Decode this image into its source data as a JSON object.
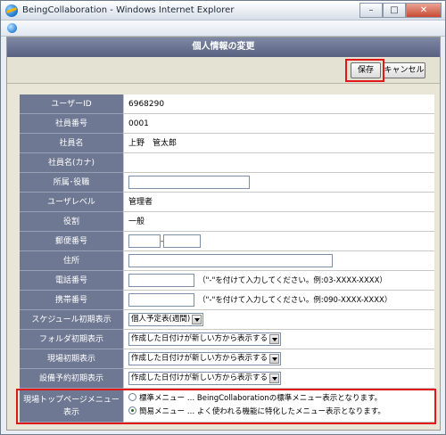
{
  "window": {
    "title": "BeingCollaboration - Windows Internet Explorer",
    "controls": {
      "minimize": "–",
      "maximize": "□",
      "close": "✕"
    }
  },
  "page": {
    "title": "個人情報の変更",
    "save_label": "保存",
    "cancel_label": "キャンセル"
  },
  "form": {
    "user_id": {
      "label": "ユーザーID",
      "value": "6968290"
    },
    "employee_no": {
      "label": "社員番号",
      "value": "0001"
    },
    "employee_name": {
      "label": "社員名",
      "value": "上野　管太郎"
    },
    "employee_name_kana": {
      "label": "社員名(カナ)",
      "value": ""
    },
    "department": {
      "label": "所属･役職",
      "value": ""
    },
    "user_level": {
      "label": "ユーザレベル",
      "value": "管理者"
    },
    "role": {
      "label": "役割",
      "value": "一般"
    },
    "postal_code": {
      "label": "郵便番号",
      "value1": "",
      "value2": "",
      "separator": "-"
    },
    "address": {
      "label": "住所",
      "value": ""
    },
    "phone": {
      "label": "電話番号",
      "value": "",
      "hint": "（\"-\"を付けて入力してください。例:03-XXXX-XXXX）"
    },
    "mobile": {
      "label": "携帯番号",
      "value": "",
      "hint": "（\"-\"を付けて入力してください。例:090-XXXX-XXXX）"
    },
    "schedule_initial": {
      "label": "スケジュール初期表示",
      "selected": "個人予定表(週間)"
    },
    "folder_initial": {
      "label": "フォルダ初期表示",
      "selected": "作成した日付けが新しい方から表示する"
    },
    "site_initial": {
      "label": "現場初期表示",
      "selected": "作成した日付けが新しい方から表示する"
    },
    "equipment_initial": {
      "label": "設備予約初期表示",
      "selected": "作成した日付けが新しい方から表示する"
    },
    "top_menu": {
      "label": "現場トップページメニュー表示",
      "options": [
        {
          "text": "標準メニュー … BeingCollaborationの標準メニュー表示となります。",
          "checked": false
        },
        {
          "text": "簡易メニュー … よく使われる機能に特化したメニュー表示となります。",
          "checked": true
        }
      ]
    }
  },
  "colors": {
    "highlight": "#e01818",
    "label_bg": "#6f7893",
    "header_bg": "#58627f"
  }
}
